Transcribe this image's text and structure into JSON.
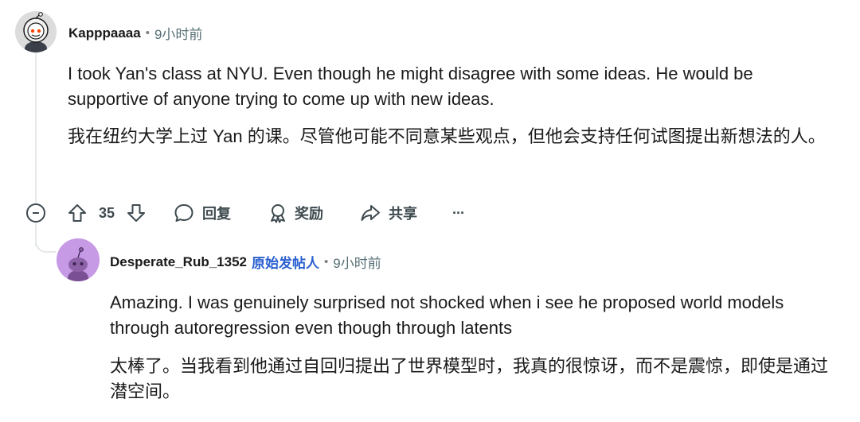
{
  "comment": {
    "username": "Kapppaaaa",
    "separator": "•",
    "time": "9小时前",
    "body_en": "I took Yan's class at NYU. Even though he might disagree with some ideas. He would be supportive of anyone trying to come up with new ideas.",
    "body_zh": "我在纽约大学上过 Yan 的课。尽管他可能不同意某些观点，但他会支持任何试图提出新想法的人。",
    "actions": {
      "upvote_count": "35",
      "reply_label": "回复",
      "award_label": "奖励",
      "share_label": "共享",
      "more_label": "···"
    }
  },
  "reply": {
    "username": "Desperate_Rub_1352",
    "op_badge": "原始发帖人",
    "separator": "•",
    "time": "9小时前",
    "body_en": "Amazing. I was genuinely surprised not shocked when i see he proposed world models through autoregression even though through latents",
    "body_zh": "太棒了。当我看到他通过自回归提出了世界模型时，我真的很惊讶，而不是震惊，即使是通过潜空间。"
  },
  "colors": {
    "text": "#1a1a1b",
    "meta": "#576f76",
    "op_badge": "#2a5fd0",
    "thread_line": "#e5e8ea",
    "reply_avatar_bg": "#c79ae6"
  }
}
